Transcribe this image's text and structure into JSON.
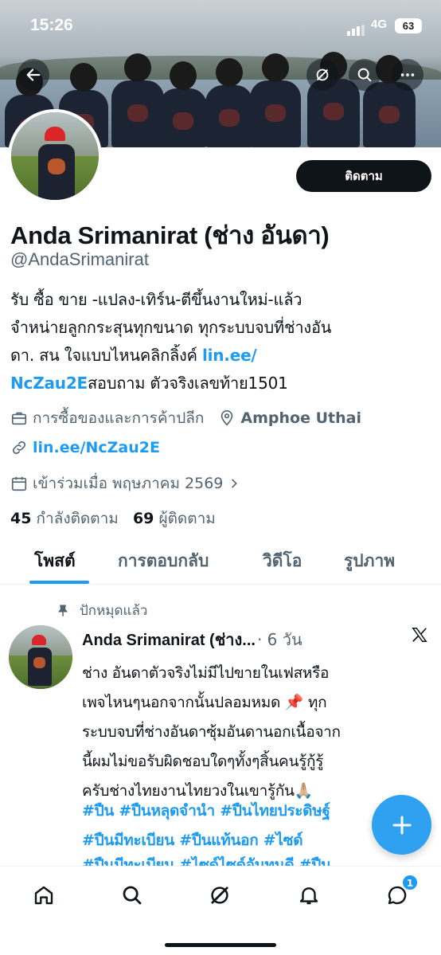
{
  "status_bar": {
    "time": "15:26",
    "network": "4G",
    "battery": "63"
  },
  "profile": {
    "follow_label": "ติดตาม",
    "display_name": "Anda Srimanirat (ช่าง อันดา)",
    "handle": "@AndaSrimanirat",
    "bio_line1": "รับ ซื้อ ขาย -แปลง-เทิร์น-ตีขึ้นงานใหม่-แล้ว",
    "bio_line2": "จำหน่ายลูกกระสุนทุกขนาด ทุกระบบจบที่ช่างอัน",
    "bio_line3_text": "ดา. สน ใจแบบไหนคลิกลิ้งค์ ",
    "bio_link_part1": "lin.ee/",
    "bio_link_part2": "NcZau2E",
    "bio_line4_text": "สอบถาม ตัวจริงเลขท้าย1501",
    "category": "การซื้อของและการค้าปลีก",
    "location": "Amphoe Uthai",
    "website": "lin.ee/NcZau2E",
    "joined": "เข้าร่วมเมื่อ พฤษภาคม 2569",
    "following_count": "45",
    "following_label": "กำลังติดตาม",
    "followers_count": "69",
    "followers_label": "ผู้ติดตาม"
  },
  "tabs": [
    "โพสต์",
    "การตอบกลับ",
    "วิดีโอ",
    "รูปภาพ"
  ],
  "pinned_post": {
    "pinned_label": "ปักหมุดแล้ว",
    "author": "Anda Srimanirat (ช่าง...",
    "date": "· 6 วัน",
    "line1": "ช่าง อันดาตัวจริงไม่มีไปขายในเฟสหรือ",
    "line2": "เพจไหนๆนอกจากนั้นปลอมหมด 📌 ทุก",
    "line3": "ระบบจบที่ช่างอันดาซุ้มอันดานอกเนื้อจาก",
    "line4": "นี้ผมไม่ขอรับผิดชอบใดๆทั้งๆสิ้นคนรู้กู้รู้",
    "line5": "ครับช่างไทยงานไทยวงในเขารู้กัน🙏🏼",
    "tags1": "#ปืน #ปืนหลุดจำนำ  #ปืนไทยประดิษฐ์",
    "tags2": "#ปืนมีทะเบียน #ปืนแท้นอก #ไซด์",
    "tags3": "#ปืนมีทะเบียน #ไซด์ไซด์อันทนดี #ปืน"
  },
  "bottom_nav": {
    "messages_badge": "1"
  },
  "colors": {
    "accent": "#1d9bf0",
    "text": "#0f1419",
    "muted": "#536471"
  },
  "icons": [
    "back-icon",
    "incognito-icon",
    "search-icon",
    "more-icon",
    "briefcase-icon",
    "location-icon",
    "link-icon",
    "calendar-icon",
    "chevron-right-icon",
    "pin-icon",
    "x-logo-icon",
    "plus-icon",
    "home-icon",
    "grok-icon",
    "bell-icon",
    "messages-icon"
  ]
}
